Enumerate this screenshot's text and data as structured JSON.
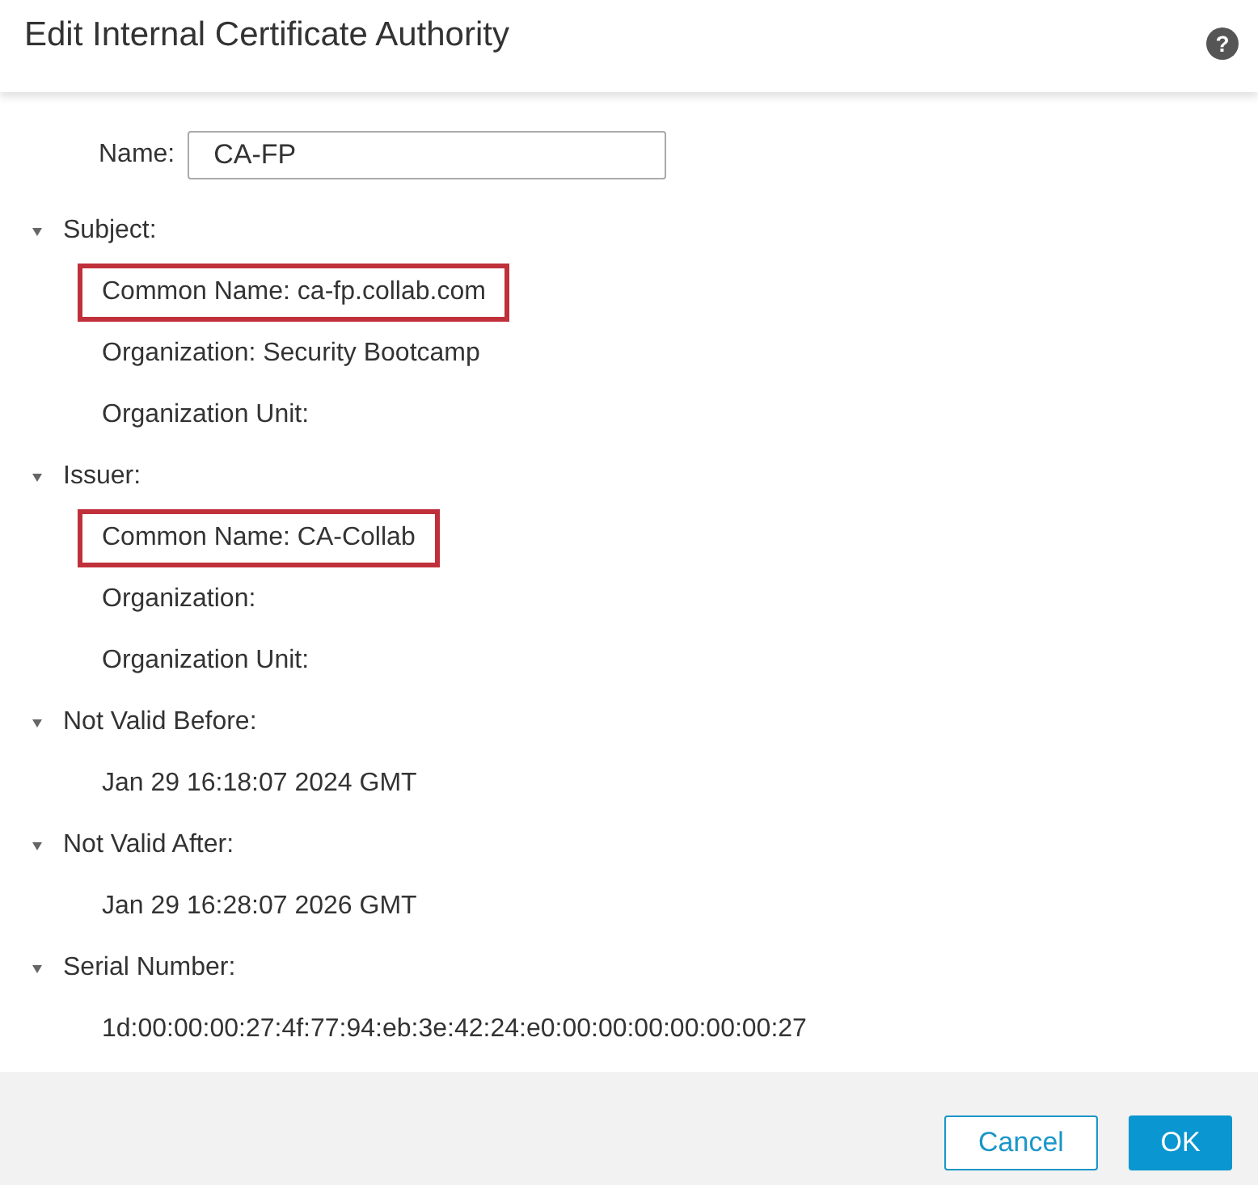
{
  "dialog": {
    "title": "Edit Internal Certificate Authority",
    "help_icon": "?"
  },
  "name_field": {
    "label": "Name:",
    "value": "CA-FP"
  },
  "sections": [
    {
      "label": "Subject:",
      "expanded": true,
      "items": [
        {
          "text": "Common Name: ca-fp.collab.com",
          "highlighted": true
        },
        {
          "text": "Organization: Security Bootcamp",
          "highlighted": false
        },
        {
          "text": "Organization Unit:",
          "highlighted": false
        }
      ]
    },
    {
      "label": "Issuer:",
      "expanded": true,
      "items": [
        {
          "text": "Common Name: CA-Collab",
          "highlighted": true
        },
        {
          "text": "Organization:",
          "highlighted": false
        },
        {
          "text": "Organization Unit:",
          "highlighted": false
        }
      ]
    },
    {
      "label": "Not Valid Before:",
      "expanded": true,
      "items": [
        {
          "text": "Jan 29 16:18:07 2024 GMT",
          "highlighted": false
        }
      ]
    },
    {
      "label": "Not Valid After:",
      "expanded": true,
      "items": [
        {
          "text": "Jan 29 16:28:07 2026 GMT",
          "highlighted": false
        }
      ]
    },
    {
      "label": "Serial Number:",
      "expanded": true,
      "items": [
        {
          "text": "1d:00:00:00:27:4f:77:94:eb:3e:42:24:e0:00:00:00:00:00:00:27",
          "highlighted": false
        }
      ]
    }
  ],
  "buttons": [
    {
      "label": "Cancel",
      "kind": "secondary"
    },
    {
      "label": "OK",
      "kind": "primary"
    }
  ]
}
